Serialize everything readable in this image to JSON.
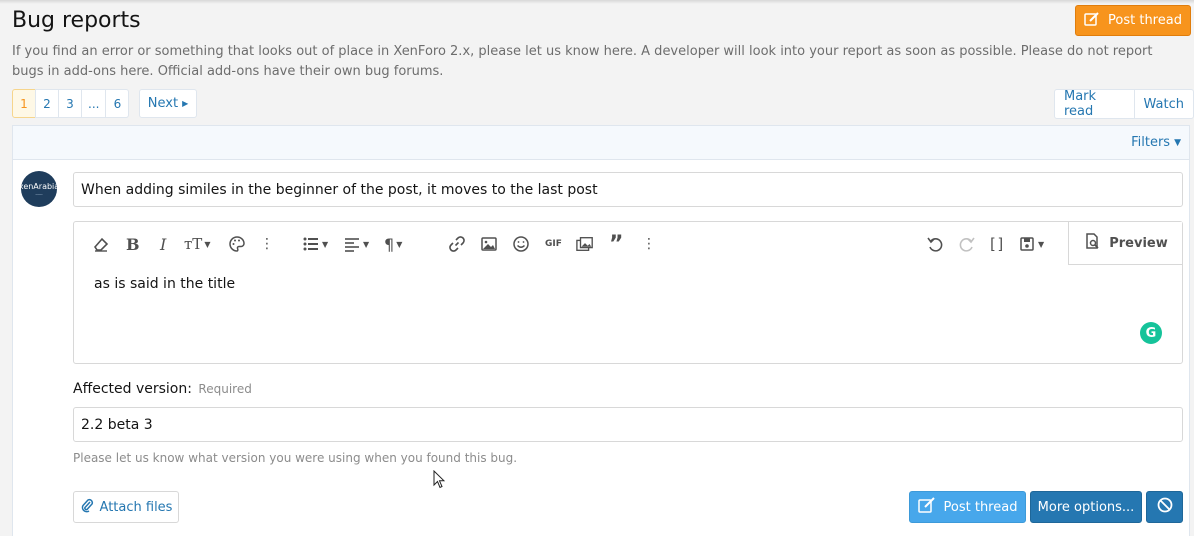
{
  "page": {
    "title": "Bug reports",
    "description": "If you find an error or something that looks out of place in XenForo 2.x, please let us know here. A developer will look into your report as soon as possible. Please do not report bugs in add-ons here. Official add-ons have their own bug forums.",
    "post_thread_label": "Post thread"
  },
  "pagination": {
    "pages": [
      "1",
      "2",
      "3",
      "...",
      "6"
    ],
    "current": "1",
    "next_label": "Next"
  },
  "actions": {
    "mark_read": "Mark read",
    "watch": "Watch",
    "filters": "Filters"
  },
  "form": {
    "avatar_text": "xenArabia",
    "title_value": "When adding similes in the beginner of the post, it moves to the last post",
    "editor_text": "as is said in the title",
    "preview_label": "Preview",
    "toolbar_gif": "GIF",
    "affected_version_label": "Affected version:",
    "required_label": "Required",
    "version_value": "2.2 beta 3",
    "version_hint": "Please let us know what version you were using when you found this bug.",
    "attach_label": "Attach files",
    "submit_label": "Post thread",
    "more_options_label": "More options..."
  },
  "colors": {
    "accent_orange": "#f7941d",
    "link_blue": "#2577b1",
    "primary_light_blue": "#47a7eb"
  }
}
